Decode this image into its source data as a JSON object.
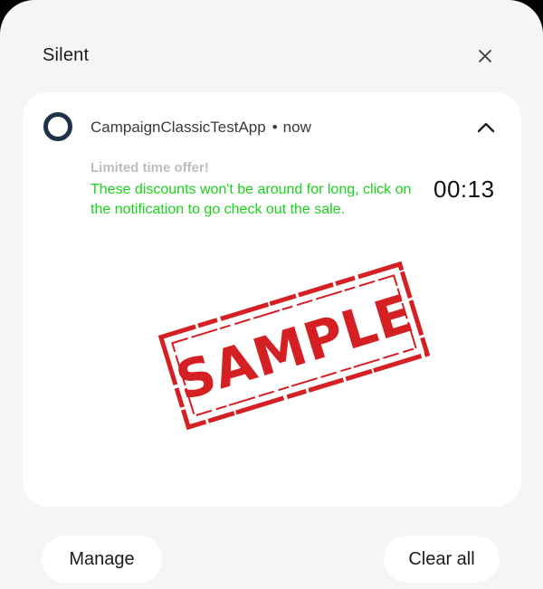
{
  "section": {
    "title": "Silent",
    "close_icon": "close-icon"
  },
  "notification": {
    "app_name": "CampaignClassicTestApp",
    "separator": "•",
    "time": "now",
    "title": "Limited time offer!",
    "body": "These discounts won't be around for long, click on the notification to go check out the sale.",
    "timer": "00:13",
    "app_icon": "app-ring-icon",
    "expand_icon": "chevron-up-icon",
    "image_text": "SAMPLE",
    "image_kind": "sample-stamp"
  },
  "actions": {
    "manage_label": "Manage",
    "clear_all_label": "Clear all"
  },
  "colors": {
    "panel_bg": "#f4f5f7",
    "card_bg": "#ffffff",
    "body_text": "#1bd11b",
    "title_text": "#bdbdbd",
    "icon_ring": "#1f3247",
    "stamp_red": "#d41f23"
  }
}
